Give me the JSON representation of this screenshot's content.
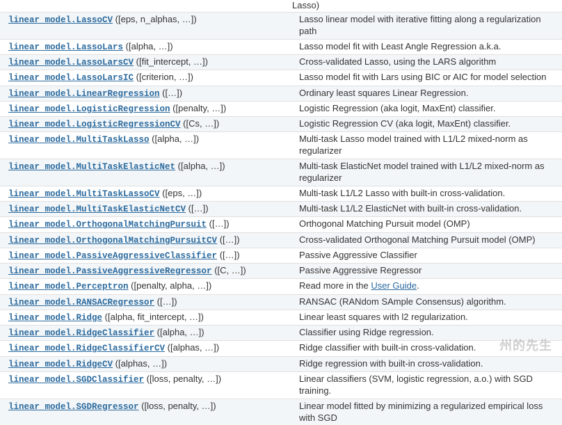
{
  "partial_top": "Lasso)",
  "rows": [
    {
      "link": "linear_model.LassoCV",
      "params": "([eps, n_alphas, …])",
      "desc": "Lasso linear model with iterative fitting along a regularization path"
    },
    {
      "link": "linear_model.LassoLars",
      "params": "([alpha, …])",
      "desc": "Lasso model fit with Least Angle Regression a.k.a."
    },
    {
      "link": "linear_model.LassoLarsCV",
      "params": "([fit_intercept, …])",
      "desc": "Cross-validated Lasso, using the LARS algorithm"
    },
    {
      "link": "linear_model.LassoLarsIC",
      "params": "([criterion, …])",
      "desc": "Lasso model fit with Lars using BIC or AIC for model selection"
    },
    {
      "link": "linear_model.LinearRegression",
      "params": "([…])",
      "desc": "Ordinary least squares Linear Regression."
    },
    {
      "link": "linear_model.LogisticRegression",
      "params": "([penalty, …])",
      "desc": "Logistic Regression (aka logit, MaxEnt) classifier."
    },
    {
      "link": "linear_model.LogisticRegressionCV",
      "params": "([Cs, …])",
      "desc": "Logistic Regression CV (aka logit, MaxEnt) classifier."
    },
    {
      "link": "linear_model.MultiTaskLasso",
      "params": "([alpha, …])",
      "desc": "Multi-task Lasso model trained with L1/L2 mixed-norm as regularizer"
    },
    {
      "link": "linear_model.MultiTaskElasticNet",
      "params": "([alpha, …])",
      "desc": "Multi-task ElasticNet model trained with L1/L2 mixed-norm as regularizer"
    },
    {
      "link": "linear_model.MultiTaskLassoCV",
      "params": "([eps, …])",
      "desc": "Multi-task L1/L2 Lasso with built-in cross-validation."
    },
    {
      "link": "linear_model.MultiTaskElasticNetCV",
      "params": "([…])",
      "desc": "Multi-task L1/L2 ElasticNet with built-in cross-validation."
    },
    {
      "link": "linear_model.OrthogonalMatchingPursuit",
      "params": "([…])",
      "desc": "Orthogonal Matching Pursuit model (OMP)"
    },
    {
      "link": "linear_model.OrthogonalMatchingPursuitCV",
      "params": "([…])",
      "desc": "Cross-validated Orthogonal Matching Pursuit model (OMP)"
    },
    {
      "link": "linear_model.PassiveAggressiveClassifier",
      "params": "([…])",
      "desc": "Passive Aggressive Classifier"
    },
    {
      "link": "linear_model.PassiveAggressiveRegressor",
      "params": "([C, …])",
      "desc": "Passive Aggressive Regressor"
    },
    {
      "link": "linear_model.Perceptron",
      "params": "([penalty, alpha, …])",
      "desc_pre": "Read more in the ",
      "desc_link": "User Guide",
      "desc_post": "."
    },
    {
      "link": "linear_model.RANSACRegressor",
      "params": "([…])",
      "desc": "RANSAC (RANdom SAmple Consensus) algorithm."
    },
    {
      "link": "linear_model.Ridge",
      "params": "([alpha, fit_intercept, …])",
      "desc": "Linear least squares with l2 regularization."
    },
    {
      "link": "linear_model.RidgeClassifier",
      "params": "([alpha, …])",
      "desc": "Classifier using Ridge regression."
    },
    {
      "link": "linear_model.RidgeClassifierCV",
      "params": "([alphas, …])",
      "desc": "Ridge classifier with built-in cross-validation."
    },
    {
      "link": "linear_model.RidgeCV",
      "params": "([alphas, …])",
      "desc": "Ridge regression with built-in cross-validation."
    },
    {
      "link": "linear_model.SGDClassifier",
      "params": "([loss, penalty, …])",
      "desc": "Linear classifiers (SVM, logistic regression, a.o.) with SGD training."
    },
    {
      "link": "linear_model.SGDRegressor",
      "params": "([loss, penalty, …])",
      "desc": "Linear model fitted by minimizing a regularized empirical loss with SGD"
    }
  ],
  "watermark": "州的先生"
}
